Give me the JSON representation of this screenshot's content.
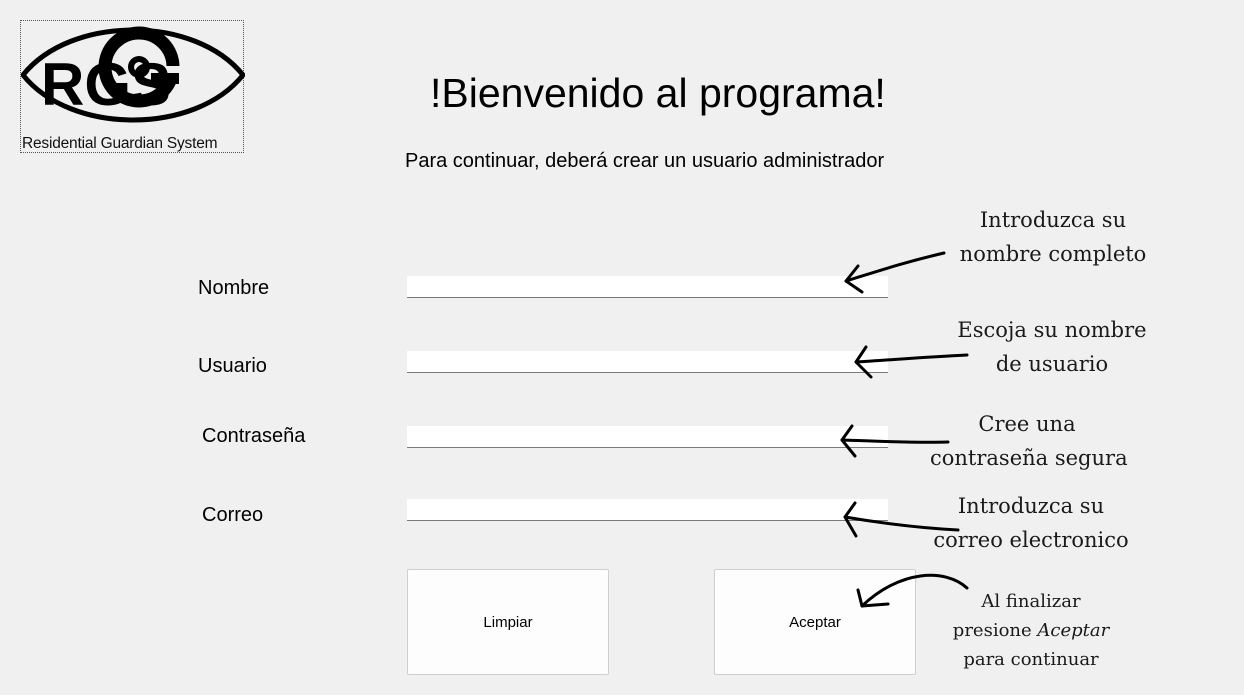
{
  "logo": {
    "letters": "RGS",
    "caption": "Residential Guardian System"
  },
  "header": {
    "title": "!Bienvenido al programa!",
    "subtitle": "Para continuar, deberá crear un usuario administrador"
  },
  "form": {
    "nombre_label": "Nombre",
    "nombre_value": "",
    "usuario_label": "Usuario",
    "usuario_value": "",
    "contrasena_label": "Contraseña",
    "contrasena_value": "",
    "correo_label": "Correo",
    "correo_value": ""
  },
  "buttons": {
    "clear_label": "Limpiar",
    "accept_label": "Aceptar"
  },
  "notes": {
    "nombre": [
      "Introduzca su",
      "nombre completo"
    ],
    "usuario": [
      "Escoja su nombre",
      "de usuario"
    ],
    "contrasena": [
      "Cree una",
      "contraseña segura"
    ],
    "correo": [
      "Introduzca su",
      "correo electronico"
    ],
    "aceptar": {
      "line1": "Al finalizar",
      "line2_prefix": "presione ",
      "line2_emphasis": "Aceptar",
      "line3": "para continuar"
    }
  },
  "colors": {
    "background": "#f0f0f0",
    "field": "#ffffff",
    "button": "#fdfdfd"
  }
}
